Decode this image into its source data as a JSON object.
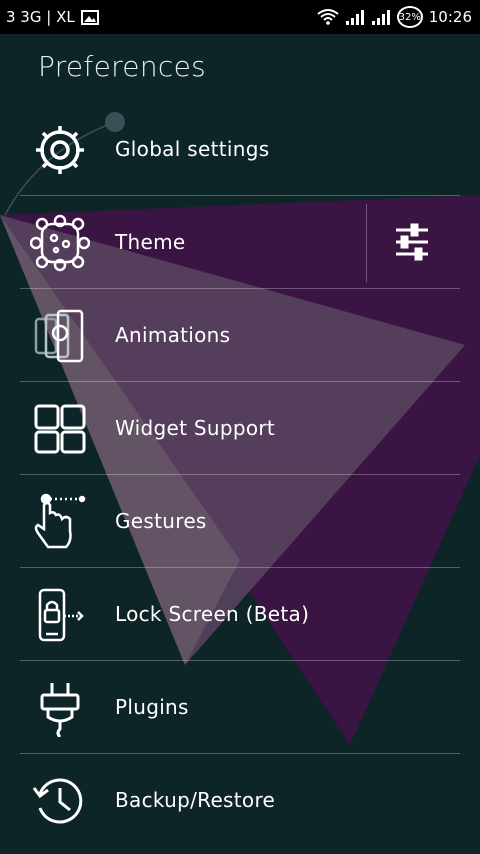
{
  "status_bar": {
    "carrier": "3 3G | XL",
    "battery": "32%",
    "time": "10:26",
    "icons": [
      "gallery-icon",
      "wifi-icon",
      "signal-icon",
      "signal-icon",
      "battery-icon"
    ]
  },
  "header": {
    "title": "Preferences"
  },
  "colors": {
    "background": "#0e2528",
    "accent": "#3d1645",
    "text": "#ffffff"
  },
  "items": [
    {
      "label": "Global settings",
      "icon": "gear-icon"
    },
    {
      "label": "Theme",
      "icon": "theme-icon",
      "action_icon": "sliders-icon"
    },
    {
      "label": "Animations",
      "icon": "animations-icon"
    },
    {
      "label": "Widget Support",
      "icon": "widget-icon"
    },
    {
      "label": "Gestures",
      "icon": "gesture-icon"
    },
    {
      "label": "Lock Screen (Beta)",
      "icon": "lock-screen-icon"
    },
    {
      "label": "Plugins",
      "icon": "plug-icon"
    },
    {
      "label": "Backup/Restore",
      "icon": "backup-icon"
    }
  ]
}
